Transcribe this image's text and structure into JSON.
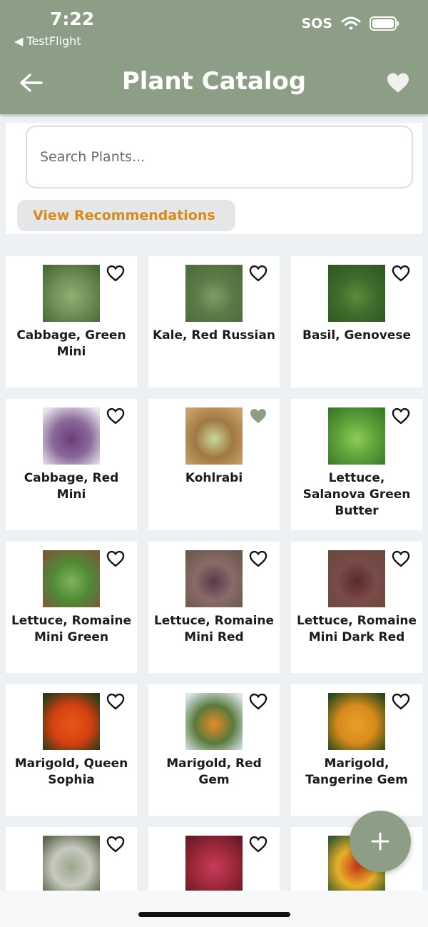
{
  "status_bar": {
    "time": "7:22",
    "back_app": "◀ TestFlight",
    "sos": "SOS"
  },
  "header": {
    "title": "Plant Catalog",
    "back_icon": "arrow-left-icon",
    "favorites_icon": "heart-filled-icon"
  },
  "search": {
    "placeholder": "Search Plants..."
  },
  "recommendations_label": "View Recommendations",
  "colors": {
    "header_bg": "#8d9e87",
    "accent": "#d88a1b",
    "favorite_filled": "#8d9e87"
  },
  "plants": [
    {
      "name": "Cabbage, Green Mini",
      "favorite": false
    },
    {
      "name": "Kale, Red Russian",
      "favorite": false
    },
    {
      "name": "Basil, Genovese",
      "favorite": false
    },
    {
      "name": "Cabbage, Red Mini",
      "favorite": false
    },
    {
      "name": "Kohlrabi",
      "favorite": true
    },
    {
      "name": "Lettuce, Salanova Green Butter",
      "favorite": false
    },
    {
      "name": "Lettuce, Romaine Mini Green",
      "favorite": false
    },
    {
      "name": "Lettuce, Romaine Mini Red",
      "favorite": false
    },
    {
      "name": "Lettuce, Romaine Mini Dark Red",
      "favorite": false
    },
    {
      "name": "Marigold, Queen Sophia",
      "favorite": false
    },
    {
      "name": "Marigold, Red Gem",
      "favorite": false
    },
    {
      "name": "Marigold, Tangerine Gem",
      "favorite": false
    },
    {
      "name": "",
      "favorite": false
    },
    {
      "name": "",
      "favorite": false
    },
    {
      "name": "",
      "favorite": false
    }
  ],
  "fab_icon": "plus-icon"
}
